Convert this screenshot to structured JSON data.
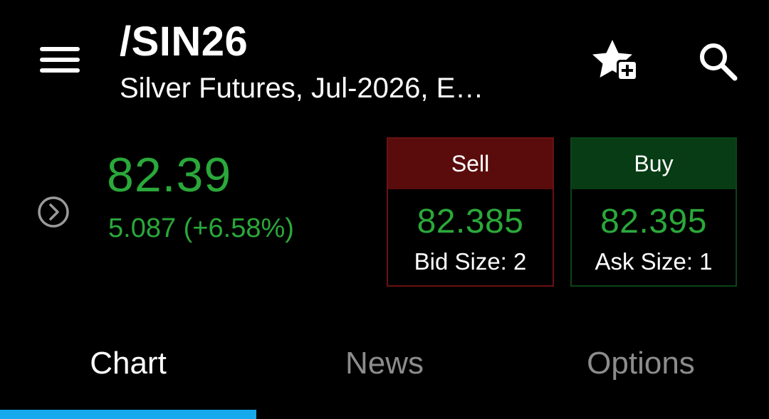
{
  "header": {
    "symbol": "/SIN26",
    "subtitle": "Silver Futures, Jul-2026, E…"
  },
  "quote": {
    "last_price": "82.39",
    "change": "5.087 (+6.58%)",
    "change_color": "#2aa83a"
  },
  "sell": {
    "label": "Sell",
    "price": "82.385",
    "size": "Bid Size: 2",
    "color": "#5a0c0c"
  },
  "buy": {
    "label": "Buy",
    "price": "82.395",
    "size": "Ask Size: 1",
    "color": "#073c14"
  },
  "tabs": [
    {
      "label": "Chart",
      "active": true
    },
    {
      "label": "News",
      "active": false
    },
    {
      "label": "Options",
      "active": false
    }
  ],
  "icons": {
    "menu": "hamburger-icon",
    "watchlist": "star-plus-icon",
    "search": "search-icon",
    "expand": "chevron-right-circle-icon"
  },
  "colors": {
    "accent": "#16a9ee",
    "positive": "#2aa83a",
    "inactive_tab": "#8c8c8c"
  }
}
